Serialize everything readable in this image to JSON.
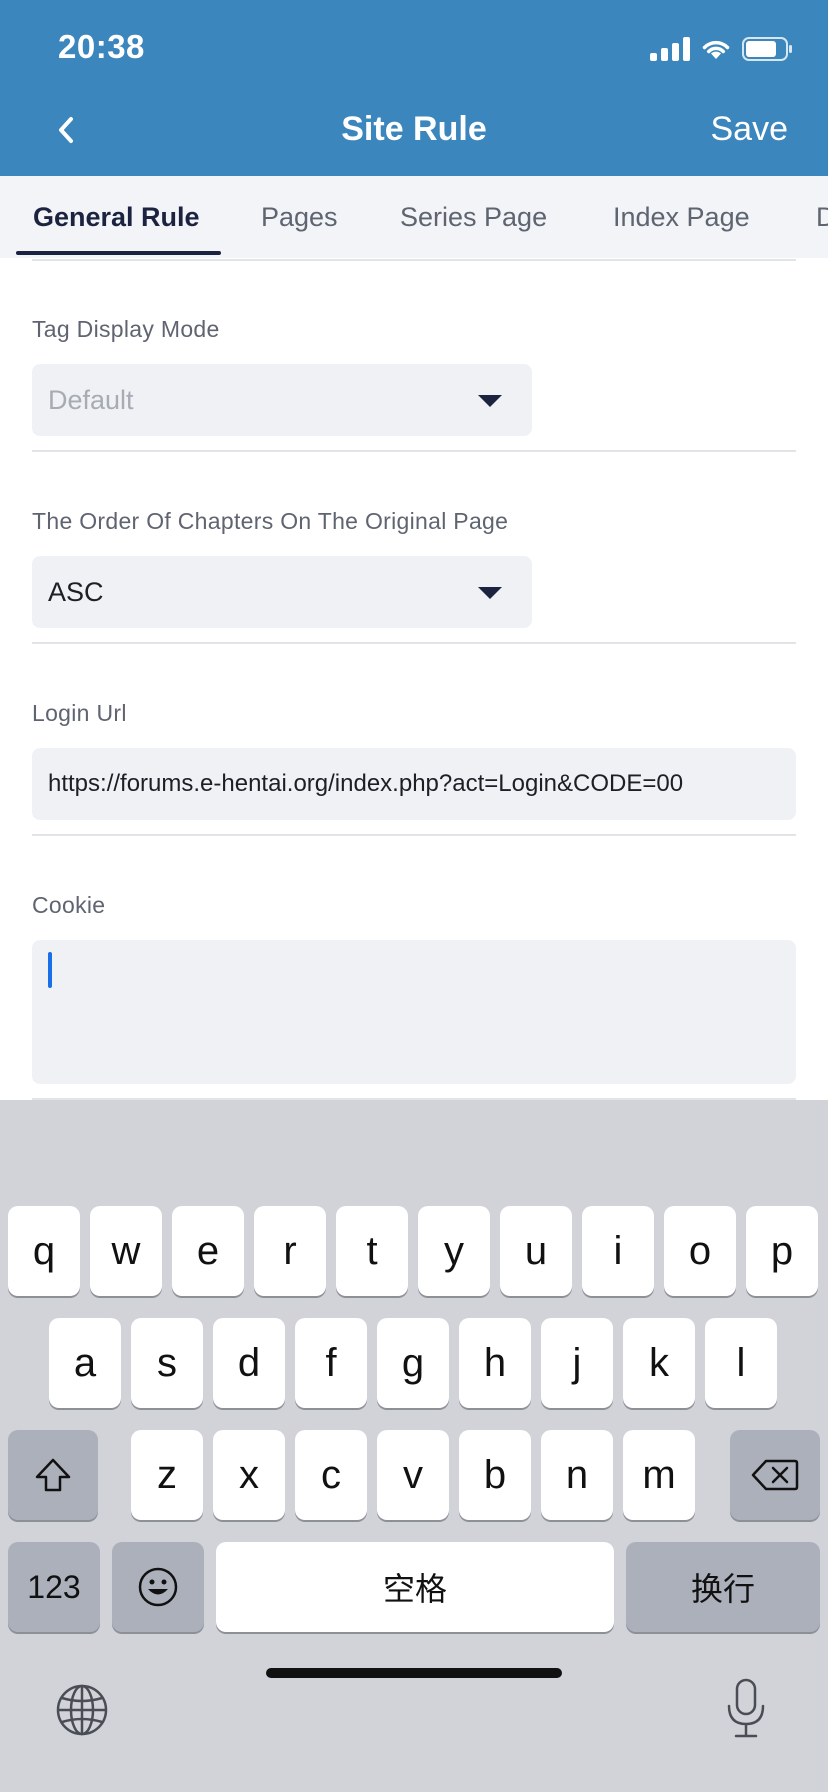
{
  "status_bar": {
    "time": "20:38"
  },
  "nav": {
    "title": "Site Rule",
    "save_label": "Save"
  },
  "tabs": [
    {
      "label": "General Rule",
      "active": true
    },
    {
      "label": "Pages",
      "active": false
    },
    {
      "label": "Series Page",
      "active": false
    },
    {
      "label": "Index Page",
      "active": false
    },
    {
      "label": "D",
      "active": false
    }
  ],
  "form": {
    "tag_display_mode": {
      "label": "Tag Display Mode",
      "placeholder": "Default"
    },
    "chapter_order": {
      "label": "The Order Of Chapters On The Original Page",
      "value": "ASC"
    },
    "login_url": {
      "label": "Login Url",
      "value": "https://forums.e-hentai.org/index.php?act=Login&CODE=00"
    },
    "cookie": {
      "label": "Cookie",
      "value": ""
    }
  },
  "keyboard": {
    "row1": [
      "q",
      "w",
      "e",
      "r",
      "t",
      "y",
      "u",
      "i",
      "o",
      "p"
    ],
    "row2": [
      "a",
      "s",
      "d",
      "f",
      "g",
      "h",
      "j",
      "k",
      "l"
    ],
    "row3": [
      "z",
      "x",
      "c",
      "v",
      "b",
      "n",
      "m"
    ],
    "numbers_label": "123",
    "space_label": "空格",
    "return_label": "换行"
  },
  "colors": {
    "header": "#3a86bd",
    "active_tab": "#1b2340",
    "cursor": "#1a6ee8"
  }
}
